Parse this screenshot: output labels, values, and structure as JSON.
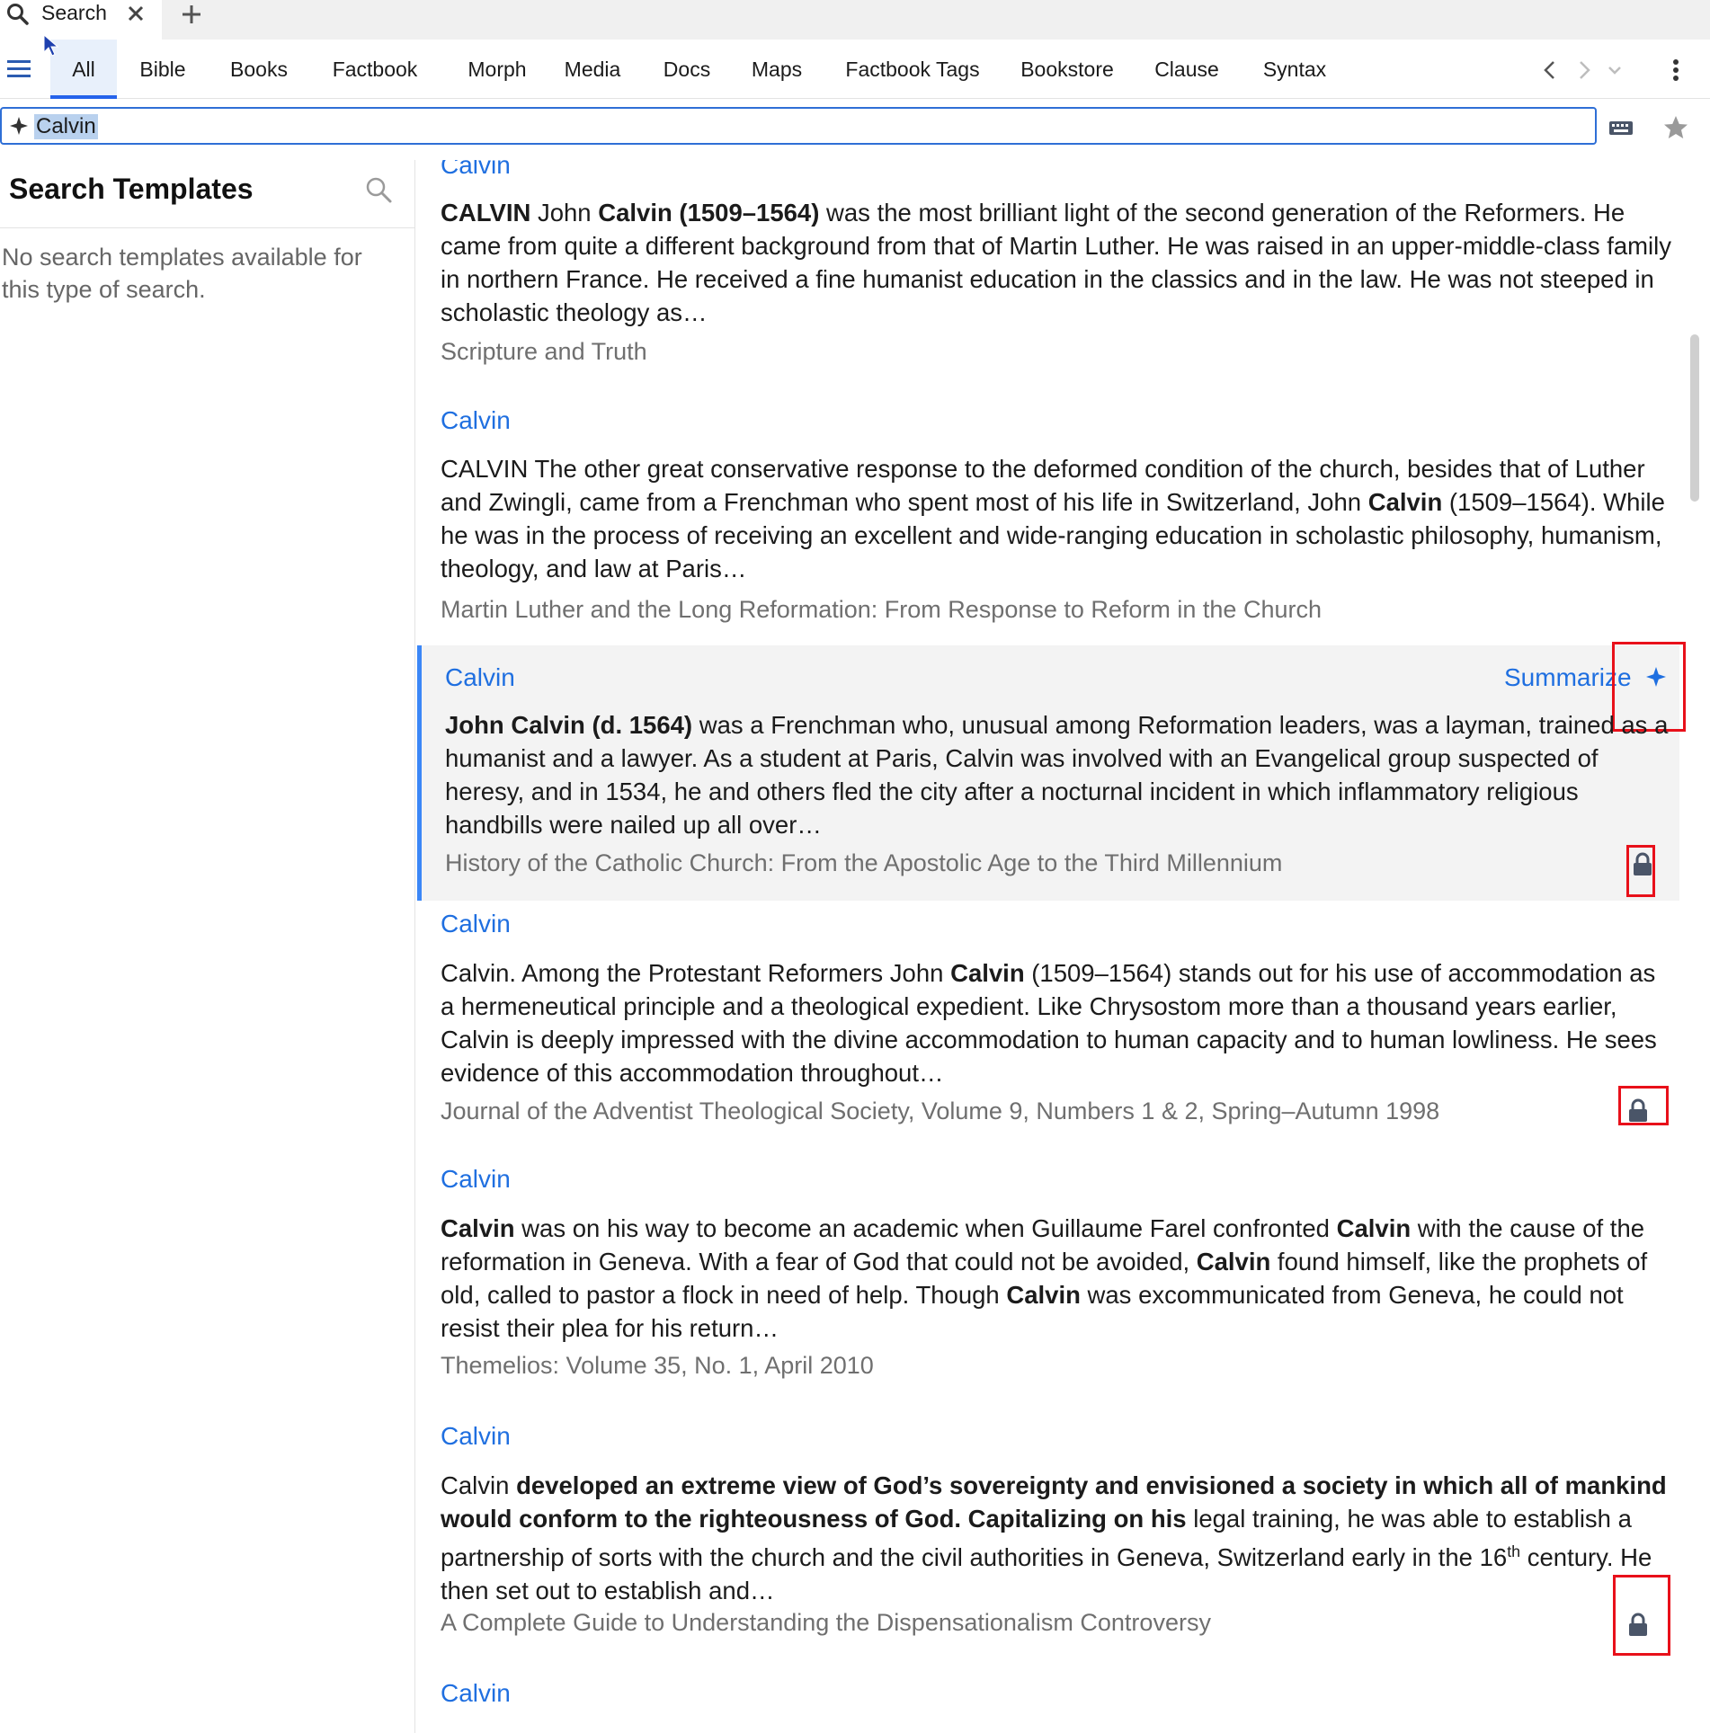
{
  "tab": {
    "title": "Search"
  },
  "categories": [
    "All",
    "Bible",
    "Books",
    "Factbook",
    "Morph",
    "Media",
    "Docs",
    "Maps",
    "Factbook Tags",
    "Bookstore",
    "Clause",
    "Syntax"
  ],
  "search": {
    "value": "Calvin"
  },
  "left_panel": {
    "title": "Search Templates",
    "empty_message": "No search templates available for this type of search."
  },
  "summarize_label": "Summarize",
  "results": [
    {
      "title": "Calvin",
      "body_parts": [
        {
          "b": true,
          "t": "CALVIN"
        },
        {
          "b": false,
          "t": " John "
        },
        {
          "b": true,
          "t": "Calvin (1509–1564)"
        },
        {
          "b": false,
          "t": " was the most brilliant light of the second generation of the Reformers. He came from quite a different background from that of Martin Luther. He was raised in an upper-middle-class family in northern France. He received a fine humanist education in the classics and in the law. He was not steeped in scholastic theology as…"
        }
      ],
      "source": "Scripture and Truth",
      "locked": false
    },
    {
      "title": "Calvin",
      "body_parts": [
        {
          "b": false,
          "t": "CALVIN The other great conservative response to the deformed condition of the church, besides that of Luther and Zwingli, came from a Frenchman who spent most of his life in Switzerland, John "
        },
        {
          "b": true,
          "t": "Calvin"
        },
        {
          "b": false,
          "t": " (1509–1564). While he was in the process of receiving an excellent and wide-ranging education in scholastic philosophy, humanism, theology, and law at Paris…"
        }
      ],
      "source": "Martin Luther and the Long Reformation: From Response to Reform in the Church",
      "locked": false
    },
    {
      "title": "Calvin",
      "body_parts": [
        {
          "b": true,
          "t": "John Calvin (d. 1564)"
        },
        {
          "b": false,
          "t": " was a Frenchman who, unusual among Reformation leaders, was a layman, trained as a humanist and a lawyer. As a student at Paris, Calvin was involved with an Evangelical group suspected of heresy, and in 1534, he and others fled the city after a nocturnal incident in which inflammatory religious handbills were nailed up all over…"
        }
      ],
      "source": "History of the Catholic Church: From the Apostolic Age to the Third Millennium",
      "locked": true
    },
    {
      "title": "Calvin",
      "body_parts": [
        {
          "b": false,
          "t": "Calvin. Among the Protestant Reformers John "
        },
        {
          "b": true,
          "t": "Calvin"
        },
        {
          "b": false,
          "t": " (1509–1564) stands out for his use of accommodation as a hermeneutical principle and a theological expedient. Like Chrysostom more than a thousand years earlier, Calvin is deeply impressed with the divine accommodation to human capacity and to human lowliness. He sees evidence of this accommodation throughout…"
        }
      ],
      "source": "Journal of the Adventist Theological Society, Volume 9, Numbers 1 & 2, Spring–Autumn 1998",
      "locked": true
    },
    {
      "title": "Calvin",
      "body_parts": [
        {
          "b": true,
          "t": "Calvin"
        },
        {
          "b": false,
          "t": " was on his way to become an academic when Guillaume Farel confronted "
        },
        {
          "b": true,
          "t": "Calvin"
        },
        {
          "b": false,
          "t": " with the cause of the reformation in Geneva. With a fear of God that could not be avoided, "
        },
        {
          "b": true,
          "t": "Calvin"
        },
        {
          "b": false,
          "t": " found himself, like the prophets of old, called to pastor a flock in need of help. Though "
        },
        {
          "b": true,
          "t": "Calvin"
        },
        {
          "b": false,
          "t": " was excommunicated from Geneva, he could not resist their plea for his return…"
        }
      ],
      "source": "Themelios: Volume 35, No. 1, April 2010",
      "locked": false
    },
    {
      "title": "Calvin",
      "body_parts": [
        {
          "b": false,
          "t": "Calvin "
        },
        {
          "b": true,
          "t": "developed an extreme view of God’s sovereignty and envisioned a society in which all of mankind would conform to the righteousness of God. Capitalizing on his"
        },
        {
          "b": false,
          "t": " legal training, he was able to establish a partnership of sorts with the church and the civil authorities in Geneva, Switzerland early in the 16"
        },
        {
          "sup": true,
          "t": "th"
        },
        {
          "b": false,
          "t": " century. He then set out to establish and…"
        }
      ],
      "source": "A Complete Guide to Understanding the Dispensationalism Controversy",
      "locked": true
    },
    {
      "title": "Calvin",
      "body_parts": [],
      "source": "",
      "locked": false
    }
  ]
}
